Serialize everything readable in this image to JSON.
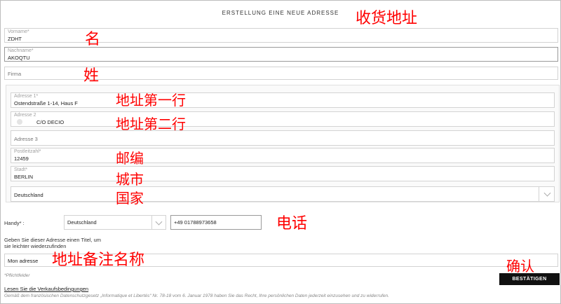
{
  "page": {
    "title": "ERSTELLUNG EINE NEUE ADRESSE"
  },
  "fields": {
    "vorname": {
      "label": "Vorname*",
      "value": "ZDHT"
    },
    "nachname": {
      "label": "Nachname*",
      "value": "AKOQTU"
    },
    "firma": {
      "placeholder": "Firma"
    },
    "adresse1": {
      "label": "Adresse 1*",
      "value": "Ostendstraße 1-14, Haus F"
    },
    "adresse2": {
      "label": "Adresse 2",
      "value": "C/O DECIO"
    },
    "adresse3": {
      "placeholder": "Adresse 3"
    },
    "plz": {
      "label": "Postleitzahl*",
      "value": "12459"
    },
    "stadt": {
      "label": "Stadt*",
      "value": "BERLIN"
    },
    "land": {
      "value": "Deutschland"
    }
  },
  "phone": {
    "label": "Handy* :",
    "country": "Deutschland",
    "number": "+49 01788973658"
  },
  "address_title": {
    "hint": "Geben Sie dieser Adresse einen Titel, um sie leichter wiederzufinden",
    "value": "Mon adresse"
  },
  "required_note": "*Pflichtfelder",
  "terms_link": "Lesen Sie die Verkaufsbedingungen",
  "legal_text": "Gemäß dem französischen Datenschutzgesetz „Informatique et Libertés“ Nr. 78-18 vom 6. Januar 1978 haben Sie das Recht, Ihre persönlichen Daten jederzeit einzusehen und zu widerrufen.",
  "confirm_button": "BESTÄTIGEN",
  "annotations": {
    "shipping_address": "收货地址",
    "first_name": "名",
    "last_name": "姓",
    "address_line1": "地址第一行",
    "address_line2": "地址第二行",
    "postal_code": "邮编",
    "city": "城市",
    "country": "国家",
    "phone": "电话",
    "address_name": "地址备注名称",
    "confirm": "确认"
  },
  "colors": {
    "annotation": "#ff0000",
    "button_bg": "#111111",
    "border": "#d3d3d3"
  }
}
